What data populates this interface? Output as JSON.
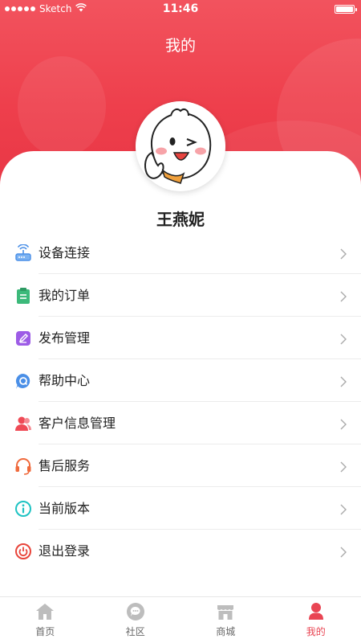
{
  "status_bar": {
    "carrier": "Sketch",
    "time": "11:46"
  },
  "header": {
    "title": "我的"
  },
  "user": {
    "name": "王燕妮"
  },
  "menu": [
    {
      "label": "设备连接",
      "icon": "router-icon"
    },
    {
      "label": "我的订单",
      "icon": "clipboard-icon"
    },
    {
      "label": "发布管理",
      "icon": "edit-icon"
    },
    {
      "label": "帮助中心",
      "icon": "help-bubble-icon"
    },
    {
      "label": "客户信息管理",
      "icon": "users-icon"
    },
    {
      "label": "售后服务",
      "icon": "headset-icon"
    },
    {
      "label": "当前版本",
      "icon": "info-icon"
    },
    {
      "label": "退出登录",
      "icon": "power-icon"
    }
  ],
  "tabbar": [
    {
      "label": "首页",
      "icon": "home-icon"
    },
    {
      "label": "社区",
      "icon": "community-icon"
    },
    {
      "label": "商城",
      "icon": "store-icon"
    },
    {
      "label": "我的",
      "icon": "profile-icon",
      "active": true
    }
  ],
  "colors": {
    "accent": "#ee3f4c",
    "active_tab": "#e94553"
  }
}
